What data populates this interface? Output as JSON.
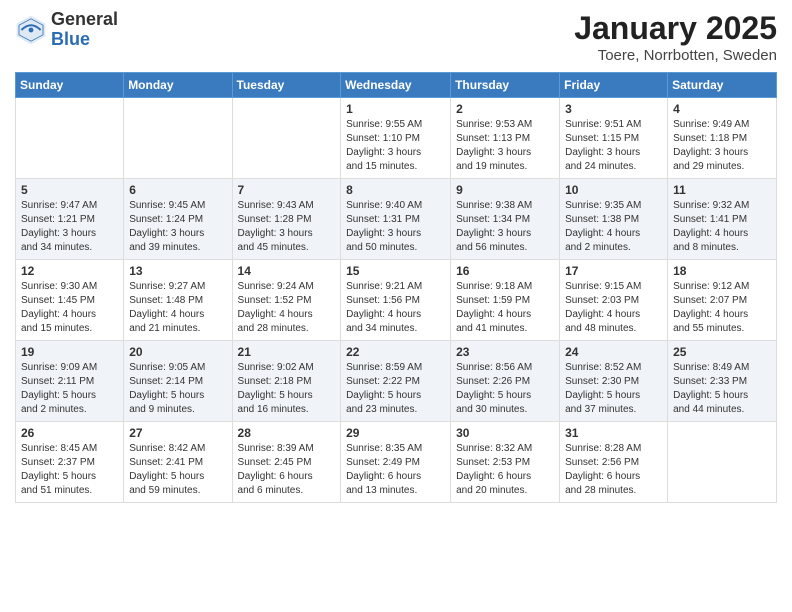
{
  "logo": {
    "general": "General",
    "blue": "Blue"
  },
  "title": "January 2025",
  "subtitle": "Toere, Norrbotten, Sweden",
  "days_header": [
    "Sunday",
    "Monday",
    "Tuesday",
    "Wednesday",
    "Thursday",
    "Friday",
    "Saturday"
  ],
  "weeks": [
    [
      {
        "day": "",
        "info": ""
      },
      {
        "day": "",
        "info": ""
      },
      {
        "day": "",
        "info": ""
      },
      {
        "day": "1",
        "info": "Sunrise: 9:55 AM\nSunset: 1:10 PM\nDaylight: 3 hours\nand 15 minutes."
      },
      {
        "day": "2",
        "info": "Sunrise: 9:53 AM\nSunset: 1:13 PM\nDaylight: 3 hours\nand 19 minutes."
      },
      {
        "day": "3",
        "info": "Sunrise: 9:51 AM\nSunset: 1:15 PM\nDaylight: 3 hours\nand 24 minutes."
      },
      {
        "day": "4",
        "info": "Sunrise: 9:49 AM\nSunset: 1:18 PM\nDaylight: 3 hours\nand 29 minutes."
      }
    ],
    [
      {
        "day": "5",
        "info": "Sunrise: 9:47 AM\nSunset: 1:21 PM\nDaylight: 3 hours\nand 34 minutes."
      },
      {
        "day": "6",
        "info": "Sunrise: 9:45 AM\nSunset: 1:24 PM\nDaylight: 3 hours\nand 39 minutes."
      },
      {
        "day": "7",
        "info": "Sunrise: 9:43 AM\nSunset: 1:28 PM\nDaylight: 3 hours\nand 45 minutes."
      },
      {
        "day": "8",
        "info": "Sunrise: 9:40 AM\nSunset: 1:31 PM\nDaylight: 3 hours\nand 50 minutes."
      },
      {
        "day": "9",
        "info": "Sunrise: 9:38 AM\nSunset: 1:34 PM\nDaylight: 3 hours\nand 56 minutes."
      },
      {
        "day": "10",
        "info": "Sunrise: 9:35 AM\nSunset: 1:38 PM\nDaylight: 4 hours\nand 2 minutes."
      },
      {
        "day": "11",
        "info": "Sunrise: 9:32 AM\nSunset: 1:41 PM\nDaylight: 4 hours\nand 8 minutes."
      }
    ],
    [
      {
        "day": "12",
        "info": "Sunrise: 9:30 AM\nSunset: 1:45 PM\nDaylight: 4 hours\nand 15 minutes."
      },
      {
        "day": "13",
        "info": "Sunrise: 9:27 AM\nSunset: 1:48 PM\nDaylight: 4 hours\nand 21 minutes."
      },
      {
        "day": "14",
        "info": "Sunrise: 9:24 AM\nSunset: 1:52 PM\nDaylight: 4 hours\nand 28 minutes."
      },
      {
        "day": "15",
        "info": "Sunrise: 9:21 AM\nSunset: 1:56 PM\nDaylight: 4 hours\nand 34 minutes."
      },
      {
        "day": "16",
        "info": "Sunrise: 9:18 AM\nSunset: 1:59 PM\nDaylight: 4 hours\nand 41 minutes."
      },
      {
        "day": "17",
        "info": "Sunrise: 9:15 AM\nSunset: 2:03 PM\nDaylight: 4 hours\nand 48 minutes."
      },
      {
        "day": "18",
        "info": "Sunrise: 9:12 AM\nSunset: 2:07 PM\nDaylight: 4 hours\nand 55 minutes."
      }
    ],
    [
      {
        "day": "19",
        "info": "Sunrise: 9:09 AM\nSunset: 2:11 PM\nDaylight: 5 hours\nand 2 minutes."
      },
      {
        "day": "20",
        "info": "Sunrise: 9:05 AM\nSunset: 2:14 PM\nDaylight: 5 hours\nand 9 minutes."
      },
      {
        "day": "21",
        "info": "Sunrise: 9:02 AM\nSunset: 2:18 PM\nDaylight: 5 hours\nand 16 minutes."
      },
      {
        "day": "22",
        "info": "Sunrise: 8:59 AM\nSunset: 2:22 PM\nDaylight: 5 hours\nand 23 minutes."
      },
      {
        "day": "23",
        "info": "Sunrise: 8:56 AM\nSunset: 2:26 PM\nDaylight: 5 hours\nand 30 minutes."
      },
      {
        "day": "24",
        "info": "Sunrise: 8:52 AM\nSunset: 2:30 PM\nDaylight: 5 hours\nand 37 minutes."
      },
      {
        "day": "25",
        "info": "Sunrise: 8:49 AM\nSunset: 2:33 PM\nDaylight: 5 hours\nand 44 minutes."
      }
    ],
    [
      {
        "day": "26",
        "info": "Sunrise: 8:45 AM\nSunset: 2:37 PM\nDaylight: 5 hours\nand 51 minutes."
      },
      {
        "day": "27",
        "info": "Sunrise: 8:42 AM\nSunset: 2:41 PM\nDaylight: 5 hours\nand 59 minutes."
      },
      {
        "day": "28",
        "info": "Sunrise: 8:39 AM\nSunset: 2:45 PM\nDaylight: 6 hours\nand 6 minutes."
      },
      {
        "day": "29",
        "info": "Sunrise: 8:35 AM\nSunset: 2:49 PM\nDaylight: 6 hours\nand 13 minutes."
      },
      {
        "day": "30",
        "info": "Sunrise: 8:32 AM\nSunset: 2:53 PM\nDaylight: 6 hours\nand 20 minutes."
      },
      {
        "day": "31",
        "info": "Sunrise: 8:28 AM\nSunset: 2:56 PM\nDaylight: 6 hours\nand 28 minutes."
      },
      {
        "day": "",
        "info": ""
      }
    ]
  ]
}
